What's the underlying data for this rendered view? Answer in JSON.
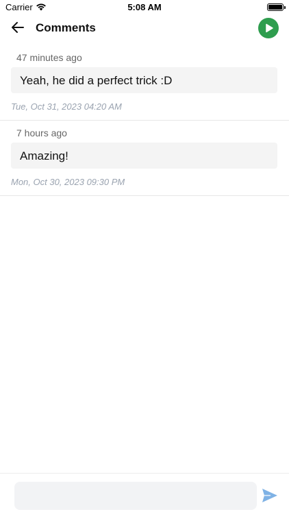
{
  "status_bar": {
    "carrier": "Carrier",
    "time": "5:08 AM"
  },
  "header": {
    "title": "Comments",
    "back_icon": "arrow-left-icon",
    "action_icon": "play-icon",
    "action_color": "#2e9d4e"
  },
  "comments": [
    {
      "relative_time": "47 minutes ago",
      "text": "Yeah, he did a perfect trick :D",
      "timestamp": "Tue, Oct 31, 2023 04:20 AM"
    },
    {
      "relative_time": "7 hours ago",
      "text": "Amazing!",
      "timestamp": "Mon, Oct 30, 2023 09:30 PM"
    }
  ],
  "composer": {
    "placeholder": "",
    "send_icon": "send-icon",
    "send_color": "#7fb2e5"
  }
}
